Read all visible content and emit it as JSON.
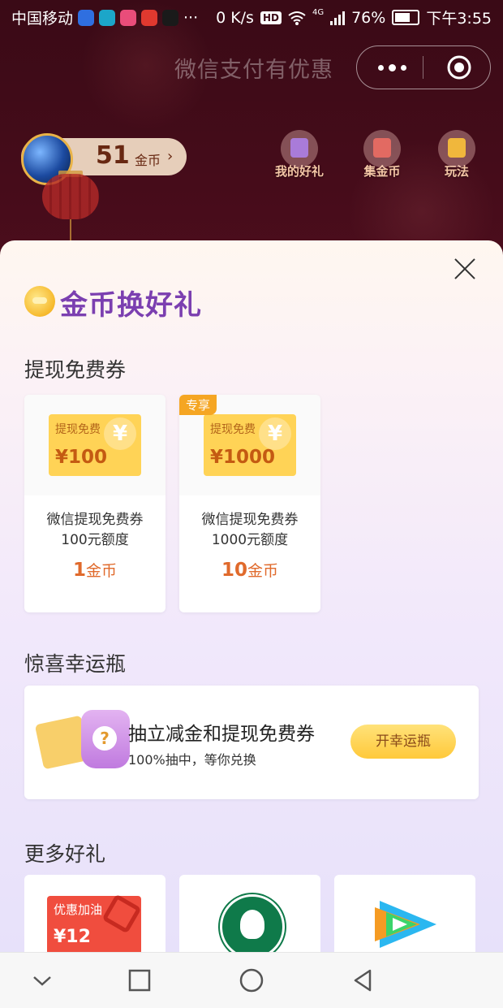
{
  "status_bar": {
    "carrier": "中国移动",
    "more": "···",
    "net_speed": "0 K/s",
    "hd": "HD",
    "network": "4G",
    "battery": "76%",
    "time": "下午3:55"
  },
  "header": {
    "title": "微信支付有优惠"
  },
  "coin_balance": {
    "amount": "51",
    "unit": "金币",
    "arrow": "›"
  },
  "top_nav": [
    {
      "label": "我的好礼",
      "icon": "gift-box-icon"
    },
    {
      "label": "集金币",
      "icon": "collect-coins-icon"
    },
    {
      "label": "玩法",
      "icon": "rules-icon"
    }
  ],
  "sheet": {
    "title": "金币换好礼",
    "sections": {
      "withdraw": {
        "title": "提现免费券",
        "cards": [
          {
            "tag": "",
            "voucher_label": "提现免费",
            "voucher_value": "¥100",
            "yen": "¥",
            "name_line1": "微信提现免费券",
            "name_line2": "100元额度",
            "price": "1",
            "unit": "金币"
          },
          {
            "tag": "专享",
            "voucher_label": "提现免费",
            "voucher_value": "¥1000",
            "yen": "¥",
            "name_line1": "微信提现免费券",
            "name_line2": "1000元额度",
            "price": "10",
            "unit": "金币"
          }
        ]
      },
      "lucky_bottle": {
        "title": "惊喜幸运瓶",
        "headline": "抽立减金和提现免费券",
        "subline": "100%抽中，等你兑换",
        "button": "开幸运瓶",
        "icon_mark": "?"
      },
      "more_gifts": {
        "title": "更多好礼",
        "items": [
          {
            "label": "优惠加油",
            "value": "¥12",
            "icon": "fuel-coupon-icon"
          },
          {
            "icon": "starbucks-logo-icon"
          },
          {
            "icon": "tencent-video-logo-icon"
          }
        ]
      }
    }
  },
  "colors": {
    "header_bg": "#3a0a16",
    "accent_purple": "#7b3fb0",
    "price_orange": "#e06a2c",
    "voucher_yellow": "#ffd356",
    "badge_orange": "#f5a623"
  }
}
